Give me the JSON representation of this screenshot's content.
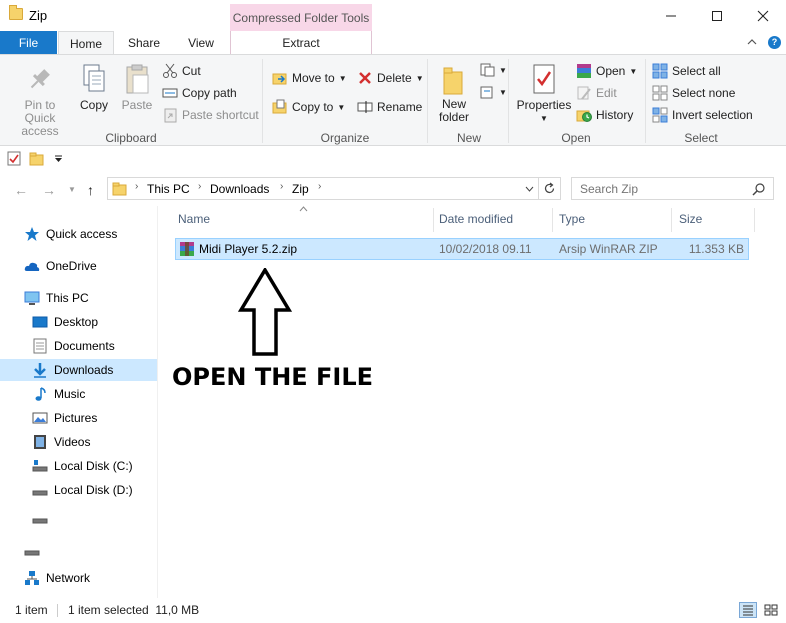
{
  "window": {
    "title": "Zip",
    "context_tab": "Compressed Folder Tools"
  },
  "tabs": {
    "file": "File",
    "home": "Home",
    "share": "Share",
    "view": "View",
    "extract": "Extract"
  },
  "ribbon": {
    "clipboard": {
      "label": "Clipboard",
      "pin": "Pin to Quick access",
      "copy": "Copy",
      "paste": "Paste",
      "cut": "Cut",
      "copy_path": "Copy path",
      "paste_shortcut": "Paste shortcut"
    },
    "organize": {
      "label": "Organize",
      "move_to": "Move to",
      "copy_to": "Copy to",
      "delete": "Delete",
      "rename": "Rename"
    },
    "new": {
      "label": "New",
      "new_folder": "New folder"
    },
    "open": {
      "label": "Open",
      "properties": "Properties",
      "open": "Open",
      "edit": "Edit",
      "history": "History"
    },
    "select": {
      "label": "Select",
      "select_all": "Select all",
      "select_none": "Select none",
      "invert": "Invert selection"
    }
  },
  "address": {
    "crumbs": [
      "This PC",
      "Downloads",
      "Zip"
    ],
    "search_placeholder": "Search Zip"
  },
  "nav": {
    "items": [
      "Quick access",
      "OneDrive",
      "This PC",
      "Desktop",
      "Documents",
      "Downloads",
      "Music",
      "Pictures",
      "Videos",
      "Local Disk (C:)",
      "Local Disk (D:)",
      "",
      "",
      "Network"
    ]
  },
  "columns": {
    "name": "Name",
    "date": "Date modified",
    "type": "Type",
    "size": "Size"
  },
  "files": [
    {
      "name": "Midi Player 5.2.zip",
      "date": "10/02/2018 09.11",
      "type": "Arsip WinRAR ZIP",
      "size": "11.353 KB"
    }
  ],
  "annotation": "OPEN THE FILE",
  "status": {
    "count": "1 item",
    "selected": "1 item selected  11,0 MB"
  },
  "colors": {
    "accent": "#1979ca",
    "selection": "#cce8ff",
    "context_tab": "#f8d7e8"
  }
}
